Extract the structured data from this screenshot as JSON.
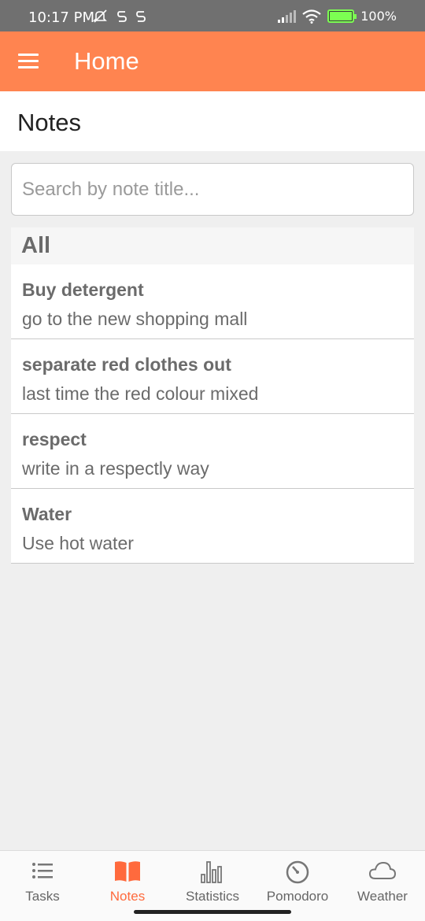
{
  "status_bar": {
    "time": "10:17 PM",
    "battery": "100%",
    "icons_left": [
      "mute-icon",
      "sync-icon",
      "sync-icon"
    ],
    "icons_right": [
      "signal-icon",
      "wifi-icon",
      "battery-charging-icon"
    ]
  },
  "app_bar": {
    "title": "Home",
    "menu_icon": "hamburger-menu-icon",
    "color": "#ff8450"
  },
  "section": {
    "title": "Notes"
  },
  "search": {
    "placeholder": "Search by note title...",
    "value": ""
  },
  "list": {
    "group": "All",
    "notes": [
      {
        "title": "Buy detergent",
        "body": "go to the new shopping mall"
      },
      {
        "title": "separate red clothes out",
        "body": "last time the red colour mixed"
      },
      {
        "title": "respect",
        "body": "write in a respectly way"
      },
      {
        "title": "Water",
        "body": "Use hot water"
      }
    ]
  },
  "bottom_nav": {
    "active_color": "#ff6a3d",
    "items": [
      {
        "label": "Tasks",
        "icon": "list-icon",
        "active": false
      },
      {
        "label": "Notes",
        "icon": "book-icon",
        "active": true
      },
      {
        "label": "Statistics",
        "icon": "bar-chart-icon",
        "active": false
      },
      {
        "label": "Pomodoro",
        "icon": "timer-icon",
        "active": false
      },
      {
        "label": "Weather",
        "icon": "cloud-icon",
        "active": false
      }
    ]
  }
}
